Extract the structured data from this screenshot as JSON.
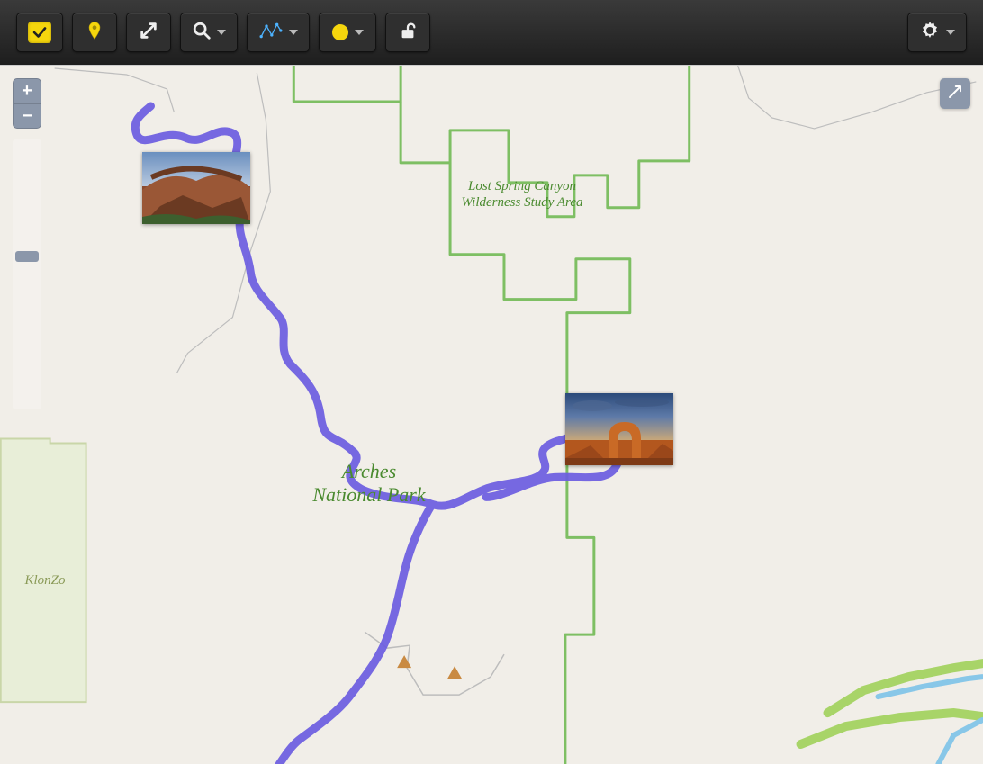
{
  "toolbar": {
    "checkbox_tool": "toggle-select",
    "pin_tool": "marker",
    "arrows_tool": "expand",
    "search_tool": "search",
    "polyline_tool": "track-line",
    "color_tool": "color-picker",
    "lock_tool": "unlocked",
    "settings_tool": "settings"
  },
  "map": {
    "zoom_in": "+",
    "zoom_out": "−",
    "labels": {
      "lost_spring": "Lost Spring Canyon Wilderness Study Area",
      "arches": "Arches National Park",
      "klonzo": "KlonZo"
    }
  },
  "track_color": "#6b5ce0",
  "park_boundary_color": "#7ebf63"
}
